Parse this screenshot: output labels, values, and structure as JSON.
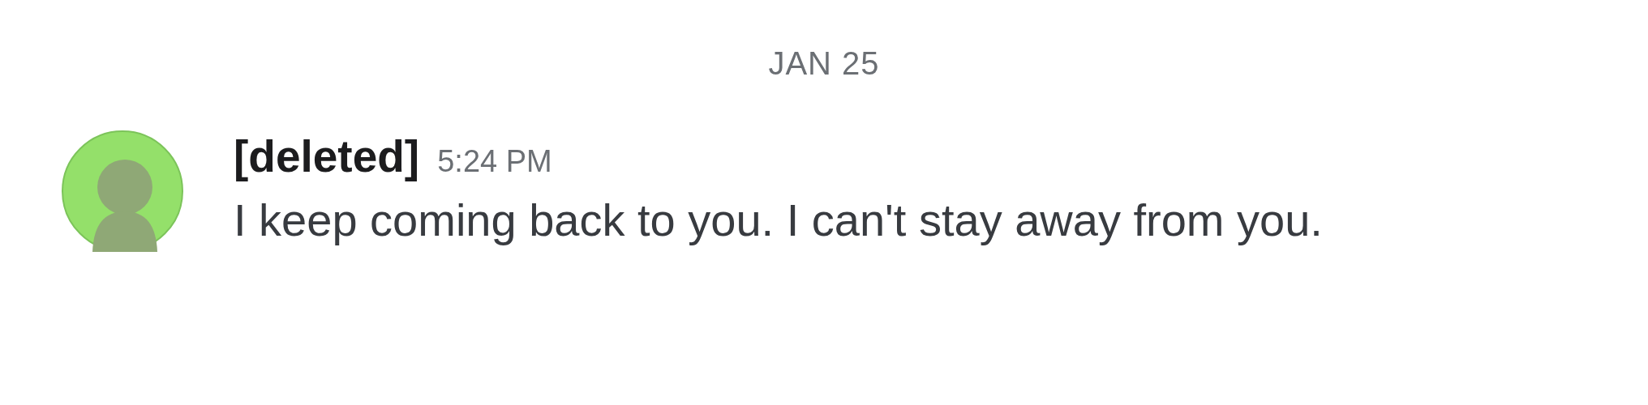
{
  "date_divider": "JAN 25",
  "message": {
    "author": "[deleted]",
    "time": "5:24 PM",
    "text": "I keep coming back to you. I can't stay away from you."
  }
}
